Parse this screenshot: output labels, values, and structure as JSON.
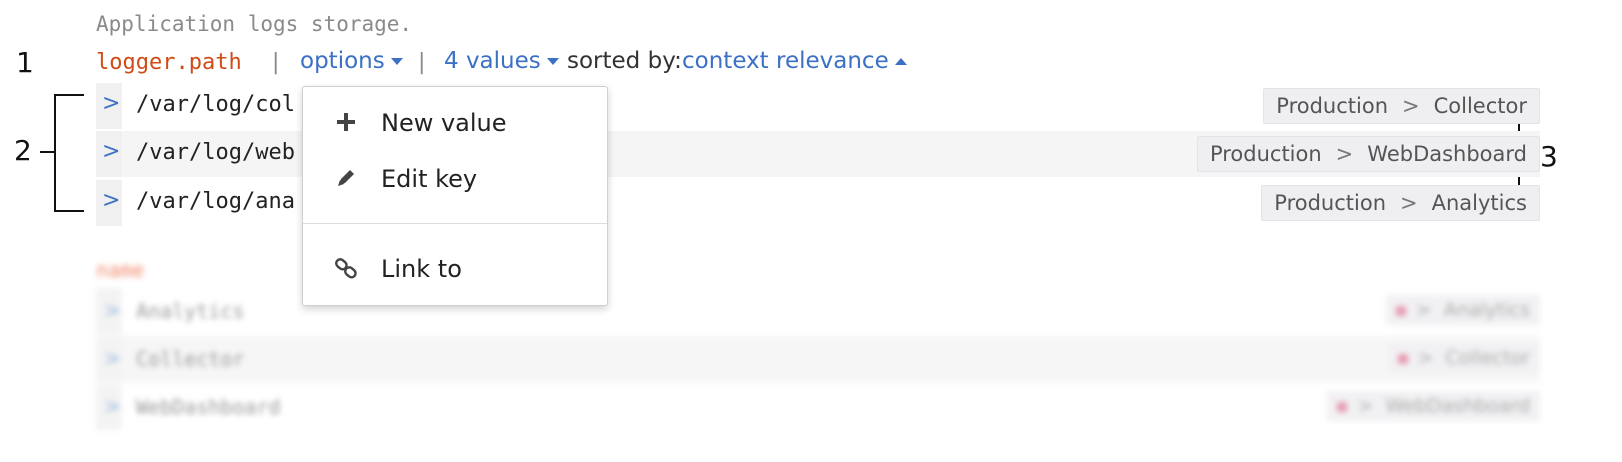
{
  "annotations": {
    "one": "1",
    "two": "2",
    "three": "3"
  },
  "header": {
    "description": "Application logs storage.",
    "key_name": "logger.path",
    "separator": "|",
    "options_label": "options",
    "values_label": "4 values",
    "sorted_by_label": "sorted by:",
    "sort_value": "context relevance"
  },
  "rows": [
    {
      "chevron": ">",
      "path": "/var/log/col",
      "crumb_env": "Production",
      "crumb_gt": ">",
      "crumb_app": "Collector"
    },
    {
      "chevron": ">",
      "path": "/var/log/web",
      "crumb_env": "Production",
      "crumb_gt": ">",
      "crumb_app": "WebDashboard"
    },
    {
      "chevron": ">",
      "path": "/var/log/ana",
      "crumb_env": "Production",
      "crumb_gt": ">",
      "crumb_app": "Analytics"
    }
  ],
  "blurred": {
    "key_name": "name",
    "rows": [
      {
        "chevron": ">",
        "value": "Analytics",
        "crumb_gt": ">",
        "crumb_app": "Analytics"
      },
      {
        "chevron": ">",
        "value": "Collector",
        "crumb_gt": ">",
        "crumb_app": "Collector"
      },
      {
        "chevron": ">",
        "value": "WebDashboard",
        "crumb_gt": ">",
        "crumb_app": "WebDashboard"
      }
    ]
  },
  "menu": {
    "items": [
      {
        "label": "New value",
        "icon": "plus-icon"
      },
      {
        "label": "Edit key",
        "icon": "pencil-icon"
      },
      {
        "label": "Link to",
        "icon": "chain-link-icon"
      }
    ]
  },
  "colors": {
    "key": "#cf4b17",
    "link": "#3b70c4",
    "muted": "#8a8a8a"
  }
}
